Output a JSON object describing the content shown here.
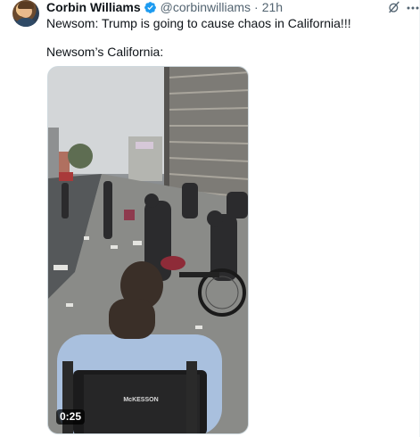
{
  "tweet": {
    "author_name": "Corbin Williams",
    "author_handle": "@corbinwilliams",
    "separator": "·",
    "time_ago": "21h",
    "verified": true,
    "text_line_1": "Newsom: Trump is going to cause chaos in California!!!",
    "text_line_2": "Newsom’s California:"
  },
  "media": {
    "type": "video",
    "duration": "0:25",
    "wheelchair_brand": "McKESSON"
  },
  "icons": {
    "grok": "grok-icon",
    "more": "more-icon",
    "verified": "verified-badge-icon"
  },
  "colors": {
    "verified_blue": "#1d9bf0",
    "secondary_text": "#536471"
  }
}
